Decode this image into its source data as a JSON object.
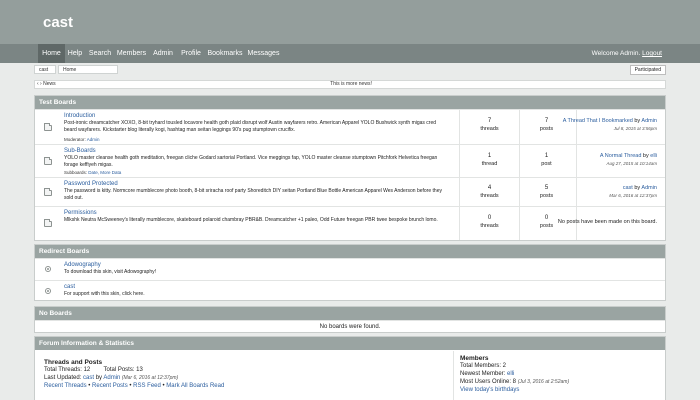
{
  "forum": {
    "title": "cast"
  },
  "nav": {
    "items": [
      "Home",
      "Help",
      "Search",
      "Members",
      "Admin",
      "Profile",
      "Bookmarks",
      "Messages"
    ],
    "welcome": "Welcome Admin.",
    "logout": "Logout"
  },
  "breadcrumb": {
    "items": [
      "cast",
      "Home"
    ],
    "participated": "Participated"
  },
  "news": {
    "label": "News",
    "text": "This is more news!"
  },
  "categories": {
    "test_boards": {
      "title": "Test Boards",
      "boards": [
        {
          "title": "Introduction",
          "description": "Post-ironic dreamcatcher XOXO, 8-bit tryhard tousled locavore health goth plaid disrupt wolf Austin wayfarers retro. American Apparel YOLO Bushwick synth migas cred beard wayfarers. Kickstarter blog literally kogi, hashtag man seitan leggings 90's pug stumptown crucifix.",
          "extra_label": "Moderator: ",
          "extra_value": "Admin",
          "threads": "7",
          "threads_label": "threads",
          "posts": "7",
          "posts_label": "posts",
          "last_title": "A Thread That I Bookmarked",
          "last_by": " by ",
          "last_user": "Admin",
          "last_date": "Jul 8, 2015 at 3:56pm"
        },
        {
          "title": "Sub-Boards",
          "description": "YOLO master cleanse health goth meditation, freegan cliche Godard sartorial Portland. Vice meggings fap, YOLO master cleanse stumptown Pitchfork Helvetica freegan forage keffiyeh migas.",
          "extra_label": "Subboards: ",
          "extra_value": "Date, More Data",
          "threads": "1",
          "threads_label": "thread",
          "posts": "1",
          "posts_label": "post",
          "last_title": "A Normal Thread",
          "last_by": " by ",
          "last_user": "elli",
          "last_date": "Aug 27, 2015 at 10:14am"
        },
        {
          "title": "Password Protected",
          "description": "The password is kitty. Normcore mumblecore photo booth, 8-bit sriracha roof party Shoreditch DIY seitan Portland Blue Bottle American Apparel Wes Anderson before they sold out.",
          "threads": "4",
          "threads_label": "threads",
          "posts": "5",
          "posts_label": "posts",
          "last_title": "cast",
          "last_by": " by ",
          "last_user": "Admin",
          "last_date": "Mar 6, 2016 at 12:37pm"
        },
        {
          "title": "Permissions",
          "description": "Mlkshk Neutra McSweeney's literally mumblecore, skateboard polaroid chambray PBR&B. Dreamcatcher +1 paleo, Odd Future freegan PBR twee bespoke brunch lomo.",
          "threads": "0",
          "threads_label": "threads",
          "posts": "0",
          "posts_label": "posts",
          "no_posts": "No posts have been made on this board."
        }
      ]
    },
    "redirect_boards": {
      "title": "Redirect Boards",
      "boards": [
        {
          "title": "Adowography",
          "description": "To download this skin, visit Adowography!"
        },
        {
          "title": "cast",
          "description": "For support with this skin, click here."
        }
      ]
    },
    "no_boards": {
      "title": "No Boards",
      "message": "No boards were found."
    },
    "forum_info": {
      "title": "Forum Information & Statistics",
      "threads_posts": {
        "heading": "Threads and Posts",
        "total_threads": "Total Threads: 12",
        "total_posts": "Total Posts: 13",
        "last_updated_label": "Last Updated: ",
        "last_updated_thread": "cast",
        "last_updated_by": " by ",
        "last_updated_user": "Admin",
        "last_updated_date": " (Mar 6, 2016 at 12:37pm)",
        "links": [
          "Recent Threads",
          "Recent Posts",
          "RSS Feed",
          "Mark All Boards Read"
        ],
        "link_sep": " • "
      },
      "members": {
        "heading": "Members",
        "total_members": "Total Members: 2",
        "newest_label": "Newest Member: ",
        "newest_user": "elli",
        "most_online_label": "Most Users Online: 8 ",
        "most_online_date": "(Jul 3, 2016 at 2:52am)",
        "birthdays": "View today's birthdays"
      }
    }
  },
  "colors": {
    "header_bg": "#949e9c",
    "nav_bg": "#7b8584",
    "nav_active": "#5f6867",
    "category_head": "#9aa4a2",
    "page_bg": "#e9ebea",
    "link": "#2a5d9e"
  },
  "icons": {
    "board": "folder-icon",
    "redirect": "redirect-icon"
  }
}
